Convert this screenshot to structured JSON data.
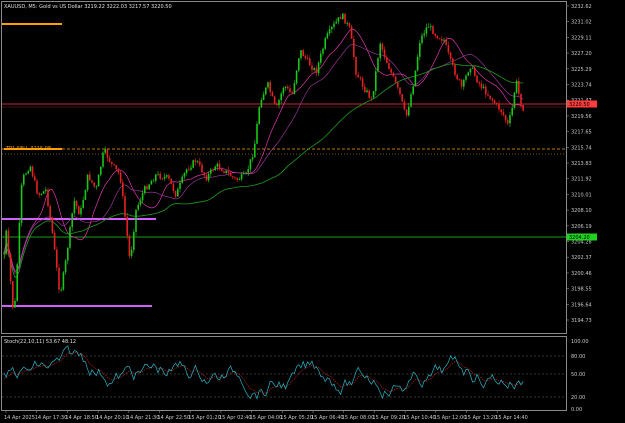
{
  "header": {
    "symbol_line": "XAUUSD, M5:  Gold vs US Dollar  3219.22 3222.03 3217.57 3220.50"
  },
  "price_axis": {
    "labels": [
      "3232.62",
      "3231.02",
      "3229.11",
      "3227.20",
      "3225.29",
      "3223.74",
      "3221.47",
      "3219.56",
      "3217.65",
      "3215.74",
      "3213.83",
      "3211.92",
      "3210.01",
      "3208.10",
      "3206.19",
      "3204.28",
      "3202.37",
      "3200.46",
      "3198.55",
      "3196.64",
      "3194.73"
    ]
  },
  "price_tags": [
    {
      "text": "3220.50",
      "color": "#ff3b3b"
    },
    {
      "text": "3204.20",
      "color": "#1fd21f"
    }
  ],
  "time_axis": {
    "labels": [
      "14 Apr 2025",
      "14 Apr 17:30",
      "14 Apr 18:50",
      "14 Apr 20:10",
      "14 Apr 21:30",
      "14 Apr 22:50",
      "15 Apr 01:20",
      "15 Apr 02:40",
      "15 Apr 04:00",
      "15 Apr 05:20",
      "15 Apr 06:40",
      "15 Apr 08:00",
      "15 Apr 09:20",
      "15 Apr 10:40",
      "15 Apr 12:00",
      "15 Apr 13:20",
      "15 Apr 14:40"
    ]
  },
  "level_label": {
    "text": "TP1:SELL 3215.08"
  },
  "indicator": {
    "title": "Stoch(22,10,11) 53.67 48.12",
    "scale_labels": [
      "100.00",
      "80.00",
      "50.00",
      "20.00",
      "0.00"
    ]
  },
  "colors": {
    "background": "#000000",
    "bull": "#19c819",
    "bear": "#e52222",
    "ma_fast": "#ff40c8",
    "ma_mid": "#b03ab0",
    "ma_slow": "#1e9c1e",
    "stoch_main": "#2bb3c6",
    "stoch_signal": "#cc2828",
    "level_orange": "#ffa000",
    "level_violet": "#d060ff",
    "bid_line": "#ff3b3b",
    "green_line": "#1fd21f"
  }
}
